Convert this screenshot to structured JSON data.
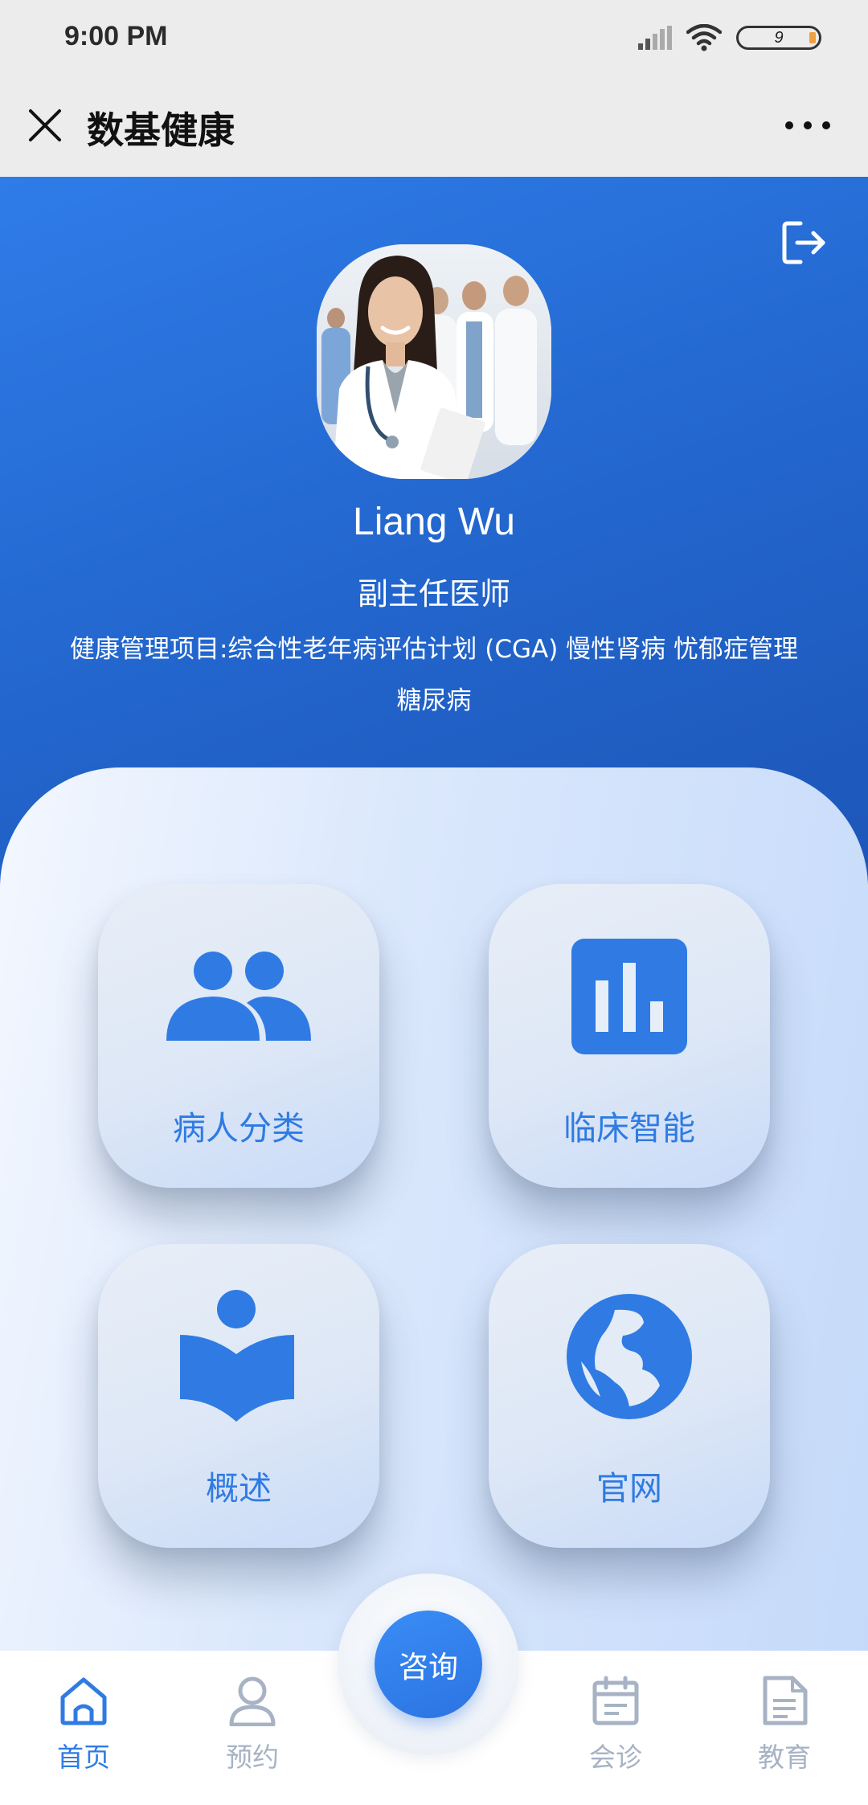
{
  "status_bar": {
    "time": "9:00 PM",
    "battery_level": "9"
  },
  "title_bar": {
    "title": "数基健康"
  },
  "profile": {
    "name": "Liang Wu",
    "position": "副主任医师",
    "projects": "健康管理项目:综合性老年病评估计划 (CGA)  慢性肾病 忧郁症管理 糖尿病"
  },
  "tiles": [
    {
      "label": "病人分类",
      "icon": "people-icon"
    },
    {
      "label": "临床智能",
      "icon": "bar-chart-icon"
    },
    {
      "label": "概述",
      "icon": "book-reader-icon"
    },
    {
      "label": "官网",
      "icon": "globe-icon"
    }
  ],
  "bottom_nav": {
    "items": [
      {
        "label": "首页",
        "icon": "home-icon",
        "active": true
      },
      {
        "label": "预约",
        "icon": "person-icon",
        "active": false
      },
      {
        "label": "会诊",
        "icon": "calendar-icon",
        "active": false
      },
      {
        "label": "教育",
        "icon": "document-icon",
        "active": false
      }
    ],
    "center_button": "咨询"
  },
  "colors": {
    "accent": "#2f7be3",
    "header_blue": "#2367cf",
    "inactive_nav": "#a7b3c4"
  }
}
